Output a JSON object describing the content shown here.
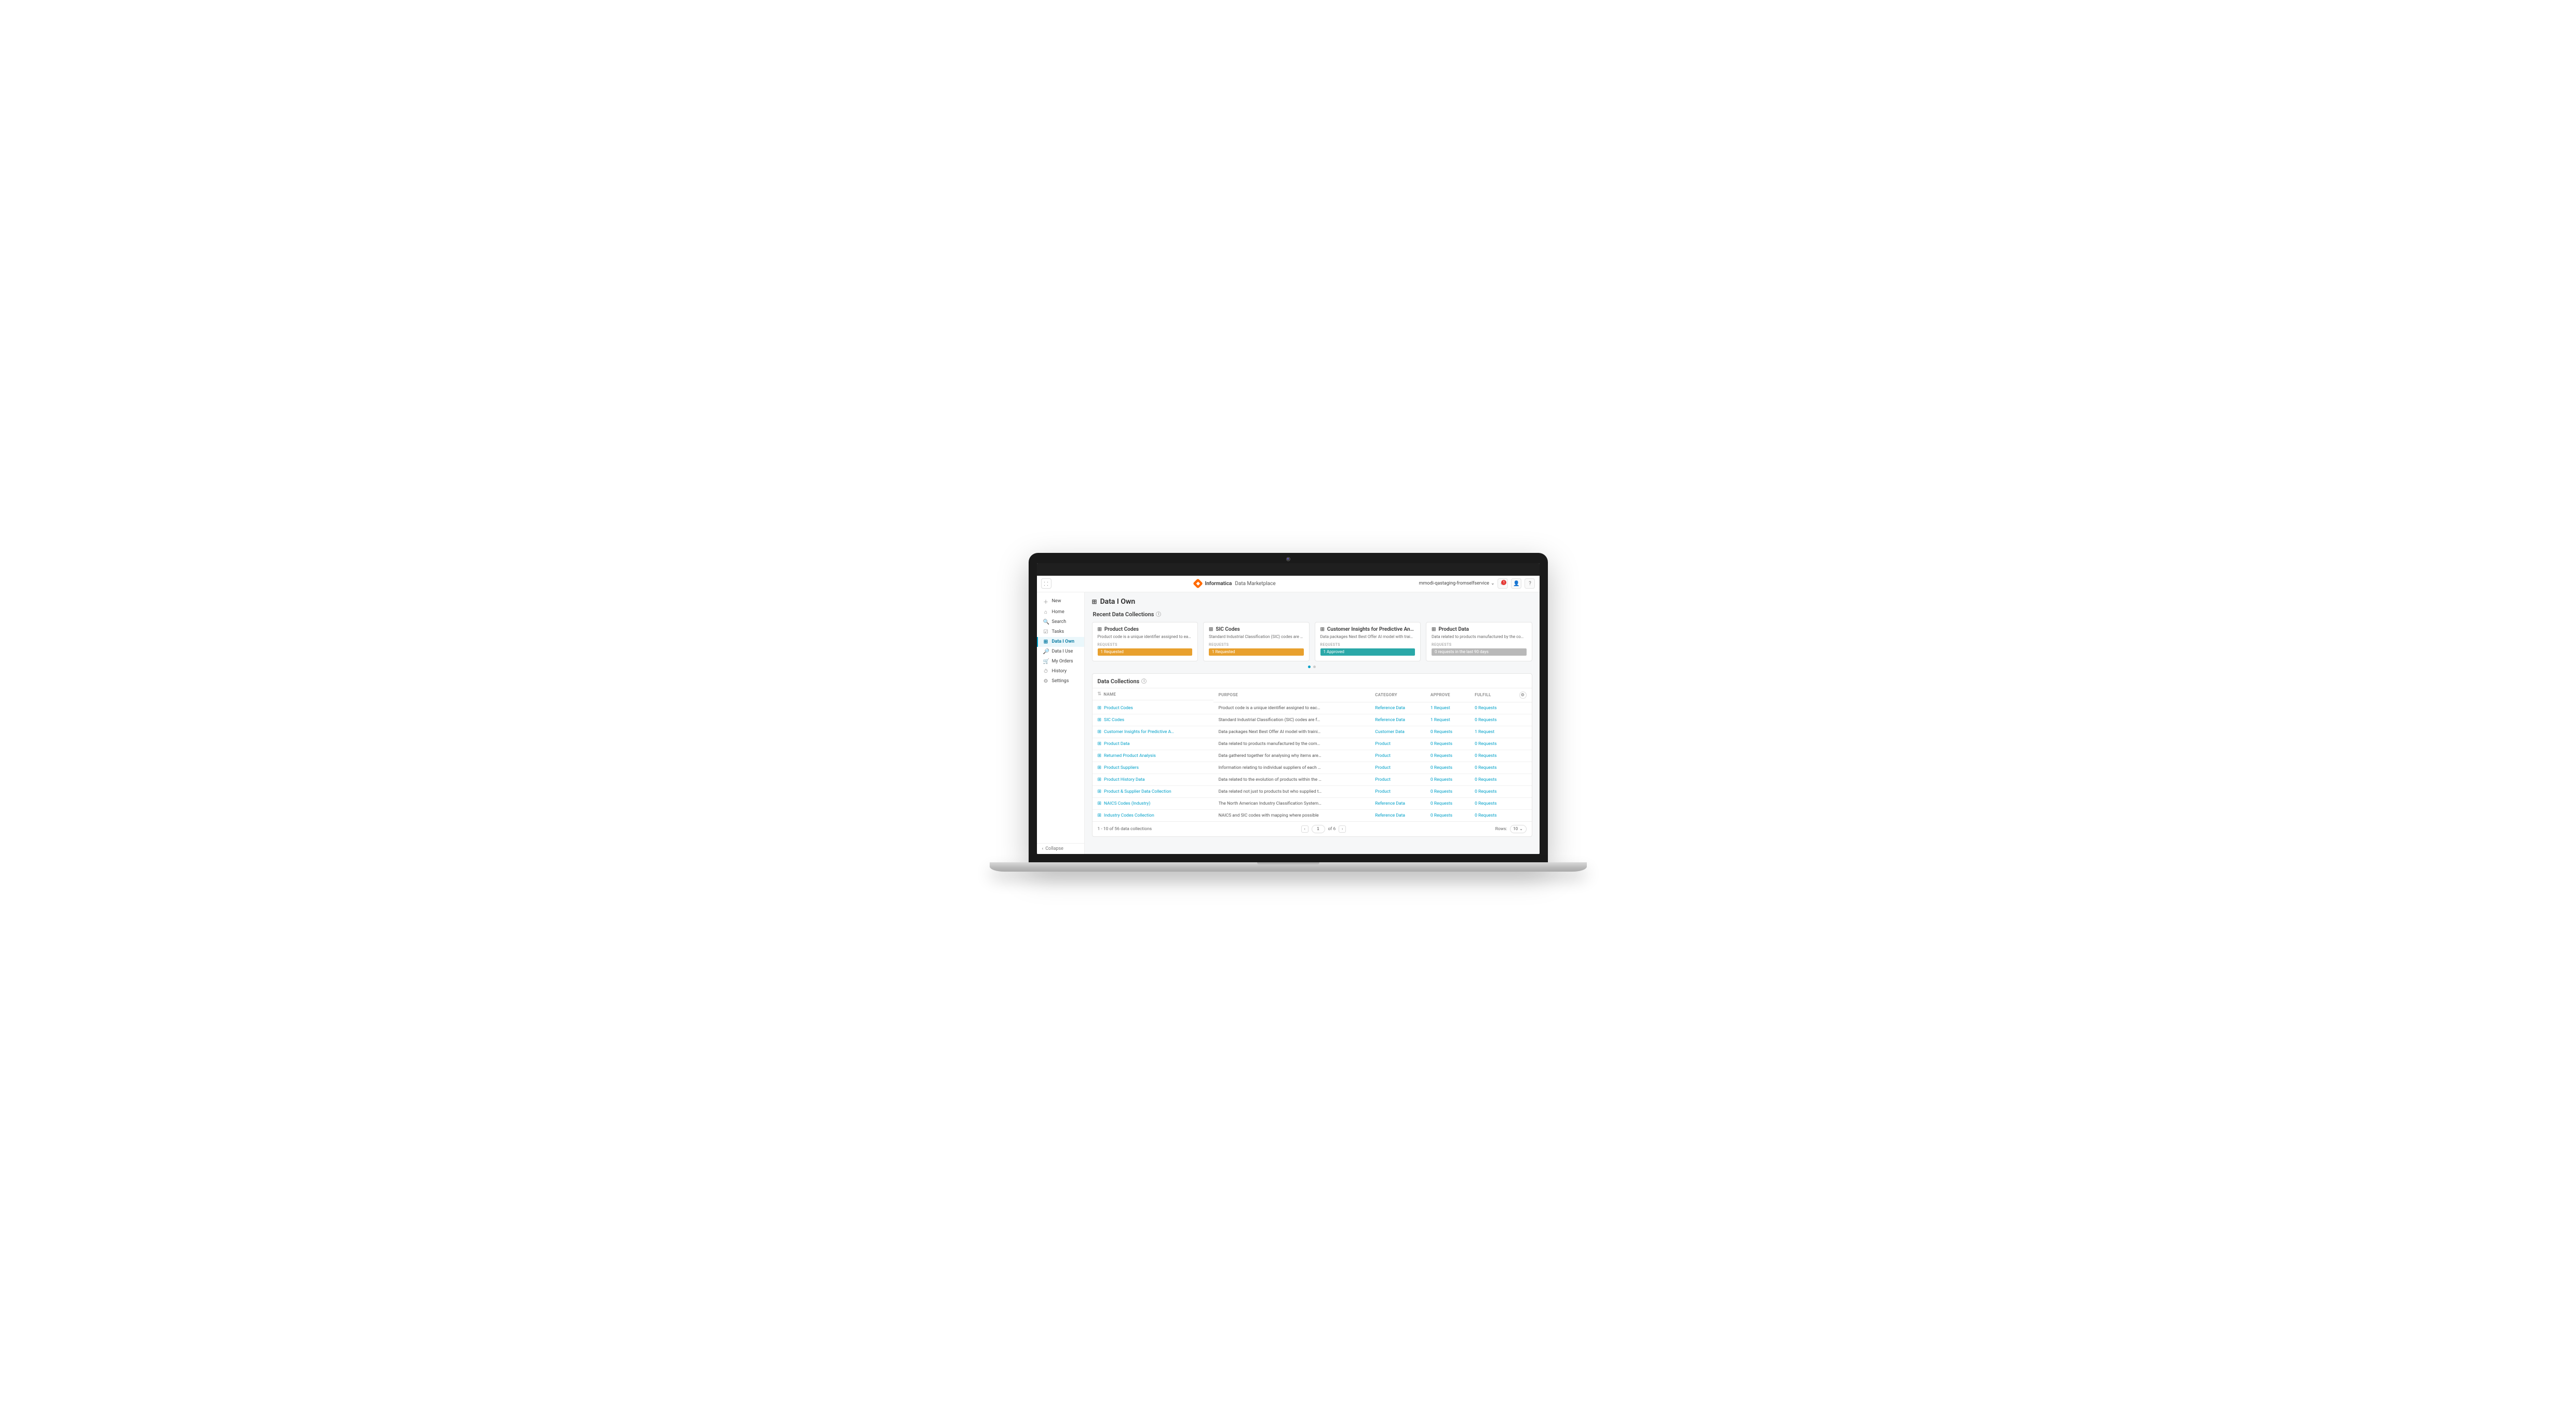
{
  "header": {
    "brand": "Informatica",
    "product": "Data Marketplace",
    "org": "mmodi-qastaging-fromselfservice",
    "notif_count": "1"
  },
  "sidebar": {
    "items": [
      {
        "icon": "＋",
        "label": "New"
      },
      {
        "icon": "⌂",
        "label": "Home"
      },
      {
        "icon": "🔍",
        "label": "Search"
      },
      {
        "icon": "☑",
        "label": "Tasks"
      },
      {
        "icon": "⊞",
        "label": "Data I Own"
      },
      {
        "icon": "🔎",
        "label": "Data I Use"
      },
      {
        "icon": "🛒",
        "label": "My Orders"
      },
      {
        "icon": "⏱",
        "label": "History"
      },
      {
        "icon": "⚙",
        "label": "Settings"
      }
    ],
    "active_index": 4,
    "collapse": "Collapse"
  },
  "page": {
    "title": "Data I Own",
    "recent_title": "Recent Data Collections",
    "collections_title": "Data Collections",
    "requests_label": "REQUESTS"
  },
  "cards": [
    {
      "title": "Product Codes",
      "desc": "Product code is a unique identifier assigned to each finished …",
      "badge": "1 Requested",
      "style": "orange"
    },
    {
      "title": "SIC Codes",
      "desc": "Standard Industrial Classification (SIC) codes are four-digit…",
      "badge": "1 Requested",
      "style": "orange"
    },
    {
      "title": "Customer Insights for Predictive Analyti…",
      "desc": "Data packages Next Best Offer AI model with training data on…",
      "badge": "1 Approved",
      "style": "teal"
    },
    {
      "title": "Product Data",
      "desc": "Data related to products manufactured by the company.",
      "badge": "0 requests in the last 90 days",
      "style": "gray"
    }
  ],
  "table": {
    "headers": {
      "name": "NAME",
      "purpose": "PURPOSE",
      "category": "CATEGORY",
      "approve": "APPROVE",
      "fulfill": "FULFILL"
    },
    "rows": [
      {
        "name": "Product Codes",
        "purpose": "Product code is a unique identifier assigned to each finish…",
        "category": "Reference Data",
        "approve": "1 Request",
        "fulfill": "0 Requests"
      },
      {
        "name": "SIC Codes",
        "purpose": "Standard Industrial Classification (SIC) codes are four-digi…",
        "category": "Reference Data",
        "approve": "1 Request",
        "fulfill": "0 Requests"
      },
      {
        "name": "Customer Insights for Predictive Ana…",
        "purpose": "Data packages Next Best Offer AI model with training data…",
        "category": "Customer Data",
        "approve": "0 Requests",
        "fulfill": "1 Request"
      },
      {
        "name": "Product Data",
        "purpose": "Data related to products manufactured by the company.",
        "category": "Product",
        "approve": "0 Requests",
        "fulfill": "0 Requests"
      },
      {
        "name": "Returned Product Analysis",
        "purpose": "Data gathered together for analysing why items are return…",
        "category": "Product",
        "approve": "0 Requests",
        "fulfill": "0 Requests"
      },
      {
        "name": "Product Suppliers",
        "purpose": "Information relating to individual suppliers of each product…",
        "category": "Product",
        "approve": "0 Requests",
        "fulfill": "0 Requests"
      },
      {
        "name": "Product History Data",
        "purpose": "Data related to the evolution of products within the organiz…",
        "category": "Product",
        "approve": "0 Requests",
        "fulfill": "0 Requests"
      },
      {
        "name": "Product & Supplier Data Collection",
        "purpose": "Data related not just to products but who supplied them an…",
        "category": "Product",
        "approve": "0 Requests",
        "fulfill": "0 Requests"
      },
      {
        "name": "NAICS Codes (Industry)",
        "purpose": "The North American Industry Classification System or NAI…",
        "category": "Reference Data",
        "approve": "0 Requests",
        "fulfill": "0 Requests"
      },
      {
        "name": "Industry Codes Collection",
        "purpose": "NAICS and SIC codes with mapping where possible",
        "category": "Reference Data",
        "approve": "0 Requests",
        "fulfill": "0 Requests"
      }
    ],
    "footer": {
      "range": "1 - 10 of 56 data collections",
      "page": "1",
      "total_pages": "of  6",
      "rows_label": "Rows:",
      "rows_value": "10"
    }
  }
}
